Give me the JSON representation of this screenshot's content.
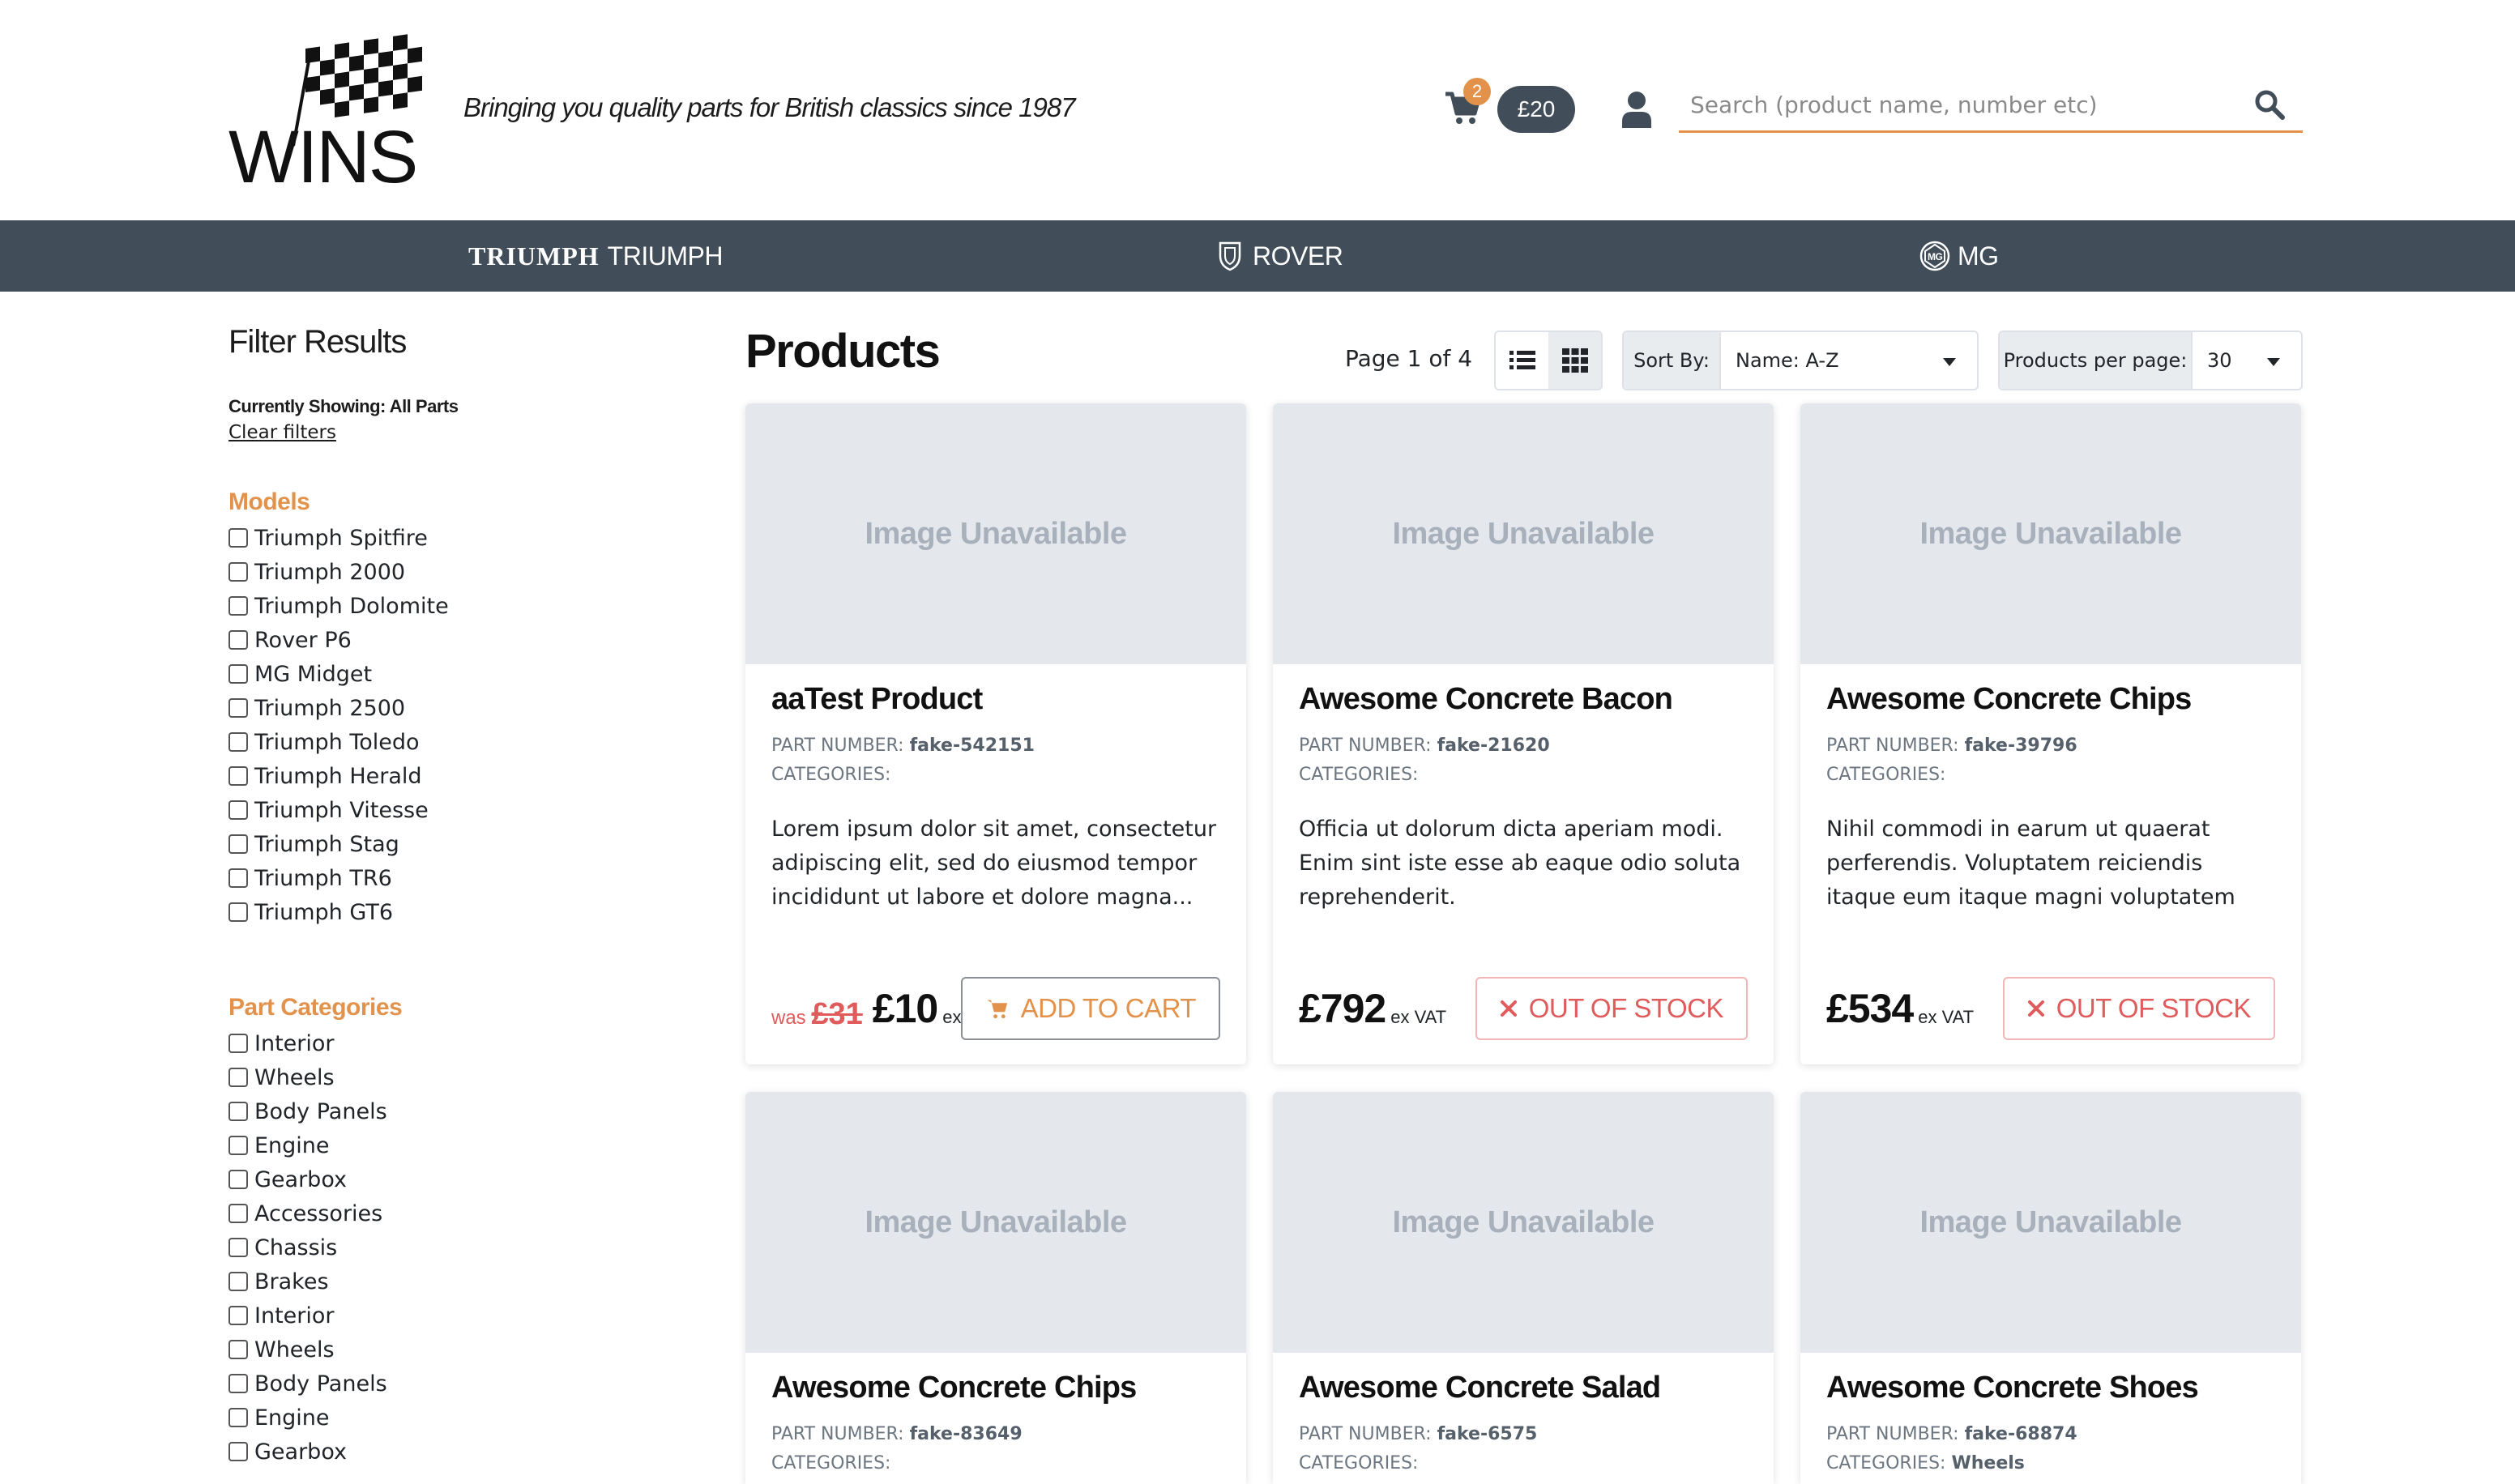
{
  "header": {
    "tagline": "Bringing you quality parts for British classics since 1987",
    "cart_count": "2",
    "cart_total": "£20",
    "search_placeholder": "Search (product name, number etc)"
  },
  "nav": {
    "items": [
      {
        "logo_text": "TRIUMPH",
        "label": "TRIUMPH"
      },
      {
        "label": "ROVER"
      },
      {
        "label": "MG"
      }
    ]
  },
  "sidebar": {
    "title": "Filter Results",
    "showing": "Currently Showing: All Parts",
    "clear": "Clear filters",
    "models_title": "Models",
    "models": [
      "Triumph Spitfire",
      "Triumph 2000",
      "Triumph Dolomite",
      "Rover P6",
      "MG Midget",
      "Triumph 2500",
      "Triumph Toledo",
      "Triumph Herald",
      "Triumph Vitesse",
      "Triumph Stag",
      "Triumph TR6",
      "Triumph GT6"
    ],
    "categories_title": "Part Categories",
    "categories": [
      "Interior",
      "Wheels",
      "Body Panels",
      "Engine",
      "Gearbox",
      "Accessories",
      "Chassis",
      "Brakes",
      "Interior",
      "Wheels",
      "Body Panels",
      "Engine",
      "Gearbox"
    ]
  },
  "toolbar": {
    "title": "Products",
    "page_info": "Page 1 of 4",
    "sort_label": "Sort By:",
    "sort_value": "Name: A-Z",
    "ppp_label": "Products per page:",
    "ppp_value": "30"
  },
  "labels": {
    "image_unavailable": "Image Unavailable",
    "part_number": "PART NUMBER:",
    "categories": "CATEGORIES:",
    "ex_vat": "ex VAT",
    "was": "was",
    "add_to_cart": "ADD TO CART",
    "out_of_stock": "OUT OF STOCK"
  },
  "products": [
    {
      "name": "aaTest Product",
      "part_number": "fake-542151",
      "categories": "",
      "description": "Lorem ipsum dolor sit amet, consectetur adipiscing elit, sed do eiusmod tempor incididunt ut labore et dolore magna...",
      "was": "£31",
      "price": "£10",
      "status": "ADD TO CART"
    },
    {
      "name": "Awesome Concrete Bacon",
      "part_number": "fake-21620",
      "categories": "",
      "description": "Officia ut dolorum dicta aperiam modi. Enim sint iste esse ab eaque odio soluta reprehenderit.",
      "price": "£792",
      "status": "OUT OF STOCK"
    },
    {
      "name": "Awesome Concrete Chips",
      "part_number": "fake-39796",
      "categories": "",
      "description": "Nihil commodi in earum ut quaerat perferendis. Voluptatem reiciendis itaque eum itaque magni voluptatem vitae ut...",
      "price": "£534",
      "status": "OUT OF STOCK"
    },
    {
      "name": "Awesome Concrete Chips",
      "part_number": "fake-83649",
      "categories": ""
    },
    {
      "name": "Awesome Concrete Salad",
      "part_number": "fake-6575",
      "categories": ""
    },
    {
      "name": "Awesome Concrete Shoes",
      "part_number": "fake-68874",
      "categories": "Wheels"
    }
  ],
  "colors": {
    "accent": "#e2924b",
    "nav_bg": "#414d58",
    "danger": "#e05b5b",
    "image_placeholder": "#e4e8ed"
  }
}
